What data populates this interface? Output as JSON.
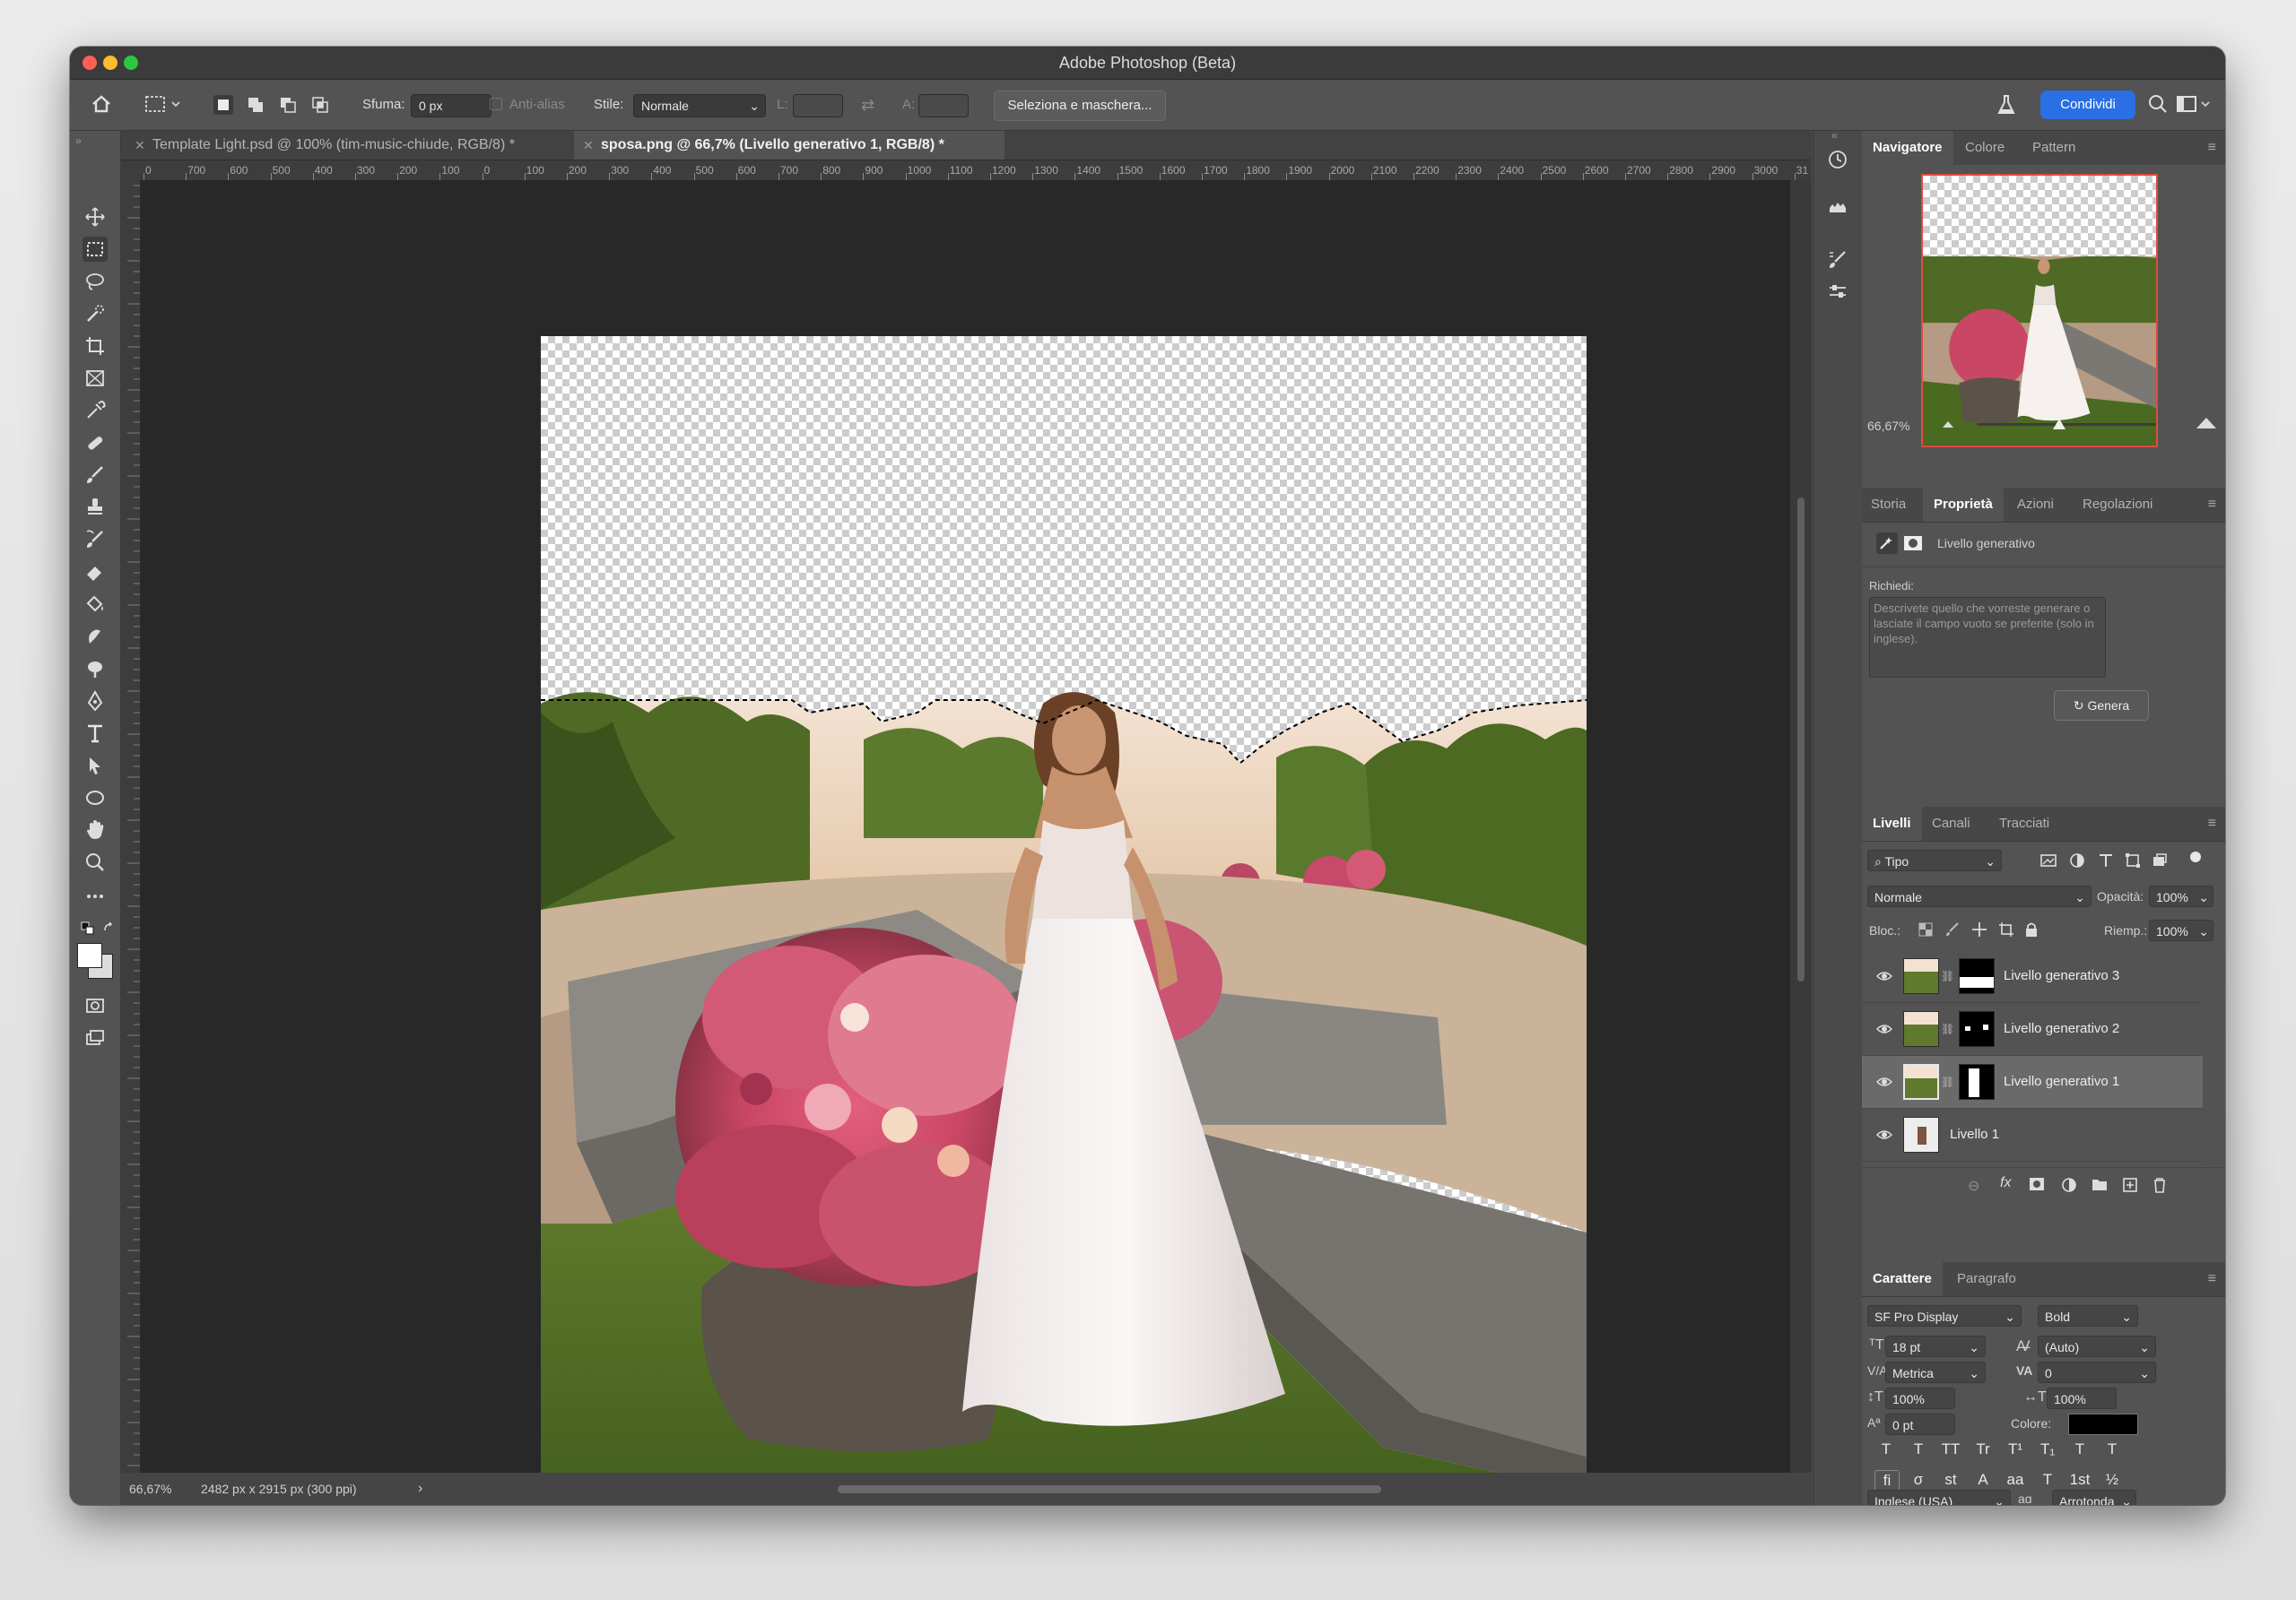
{
  "window": {
    "title": "Adobe Photoshop (Beta)"
  },
  "options_bar": {
    "feather_label": "Sfuma:",
    "feather_value": "0 px",
    "antialias_label": "Anti-alias",
    "style_label": "Stile:",
    "style_value": "Normale",
    "width_label": "L:",
    "height_label": "A:",
    "select_mask_button": "Seleziona e maschera...",
    "share_button": "Condividi"
  },
  "tabs": [
    {
      "label": "Template Light.psd @ 100% (tim-music-chiude, RGB/8) *",
      "active": false
    },
    {
      "label": "sposa.png @ 66,7% (Livello generativo 1, RGB/8) *",
      "active": true
    }
  ],
  "ruler_labels": [
    "0",
    "700",
    "600",
    "500",
    "400",
    "300",
    "200",
    "100",
    "0",
    "100",
    "200",
    "300",
    "400",
    "500",
    "600",
    "700",
    "800",
    "900",
    "1000",
    "1100",
    "1200",
    "1300",
    "1400",
    "1500",
    "1600",
    "1700",
    "1800",
    "1900",
    "2000",
    "2100",
    "2200",
    "2300",
    "2400",
    "2500",
    "2600",
    "2700",
    "2800",
    "2900",
    "3000",
    "31"
  ],
  "status_bar": {
    "zoom": "66,67%",
    "doc_info": "2482 px x 2915 px (300 ppi)",
    "arrow": "›"
  },
  "navigator": {
    "tabs": [
      "Navigatore",
      "Colore",
      "Pattern"
    ],
    "zoom": "66,67%"
  },
  "properties": {
    "tabs": [
      "Storia",
      "Proprietà",
      "Azioni",
      "Regolazioni"
    ],
    "layer_type": "Livello generativo",
    "prompt_label": "Richiedi:",
    "prompt_placeholder": "Descrivete quello che vorreste generare o lasciate il campo vuoto se preferite (solo in inglese).",
    "generate_button": "Genera"
  },
  "layers": {
    "tabs": [
      "Livelli",
      "Canali",
      "Tracciati"
    ],
    "filter_kind": "Tipo",
    "blend_mode": "Normale",
    "opacity_label": "Opacità:",
    "opacity_value": "100%",
    "lock_label": "Bloc.:",
    "fill_label": "Riemp.:",
    "fill_value": "100%",
    "items": [
      {
        "name": "Livello generativo 3",
        "selected": false
      },
      {
        "name": "Livello generativo 2",
        "selected": false
      },
      {
        "name": "Livello generativo 1",
        "selected": true
      },
      {
        "name": "Livello 1",
        "selected": false
      }
    ]
  },
  "character": {
    "tabs": [
      "Carattere",
      "Paragrafo"
    ],
    "font_family": "SF Pro Display",
    "font_style": "Bold",
    "size": "18 pt",
    "leading": "(Auto)",
    "kerning": "Metrica",
    "tracking": "0",
    "vertical_scale": "100%",
    "horizontal_scale": "100%",
    "baseline_shift": "0 pt",
    "color_label": "Colore:",
    "color_value": "#000000",
    "language": "Inglese (USA)",
    "aa_label": "aɑ",
    "antialias": "Arrotonda",
    "style_buttons": [
      "T",
      "T",
      "TT",
      "Tr",
      "T¹",
      "T₁",
      "T",
      "T"
    ],
    "opentype_buttons": [
      "fi",
      "σ",
      "st",
      "A",
      "aa",
      "T",
      "1st",
      "½"
    ]
  },
  "colors": {
    "share_blue": "#2a6fe3",
    "panel_bg": "#535353",
    "canvas_bg": "#282828",
    "selected_layer": "#6a6a6a"
  }
}
